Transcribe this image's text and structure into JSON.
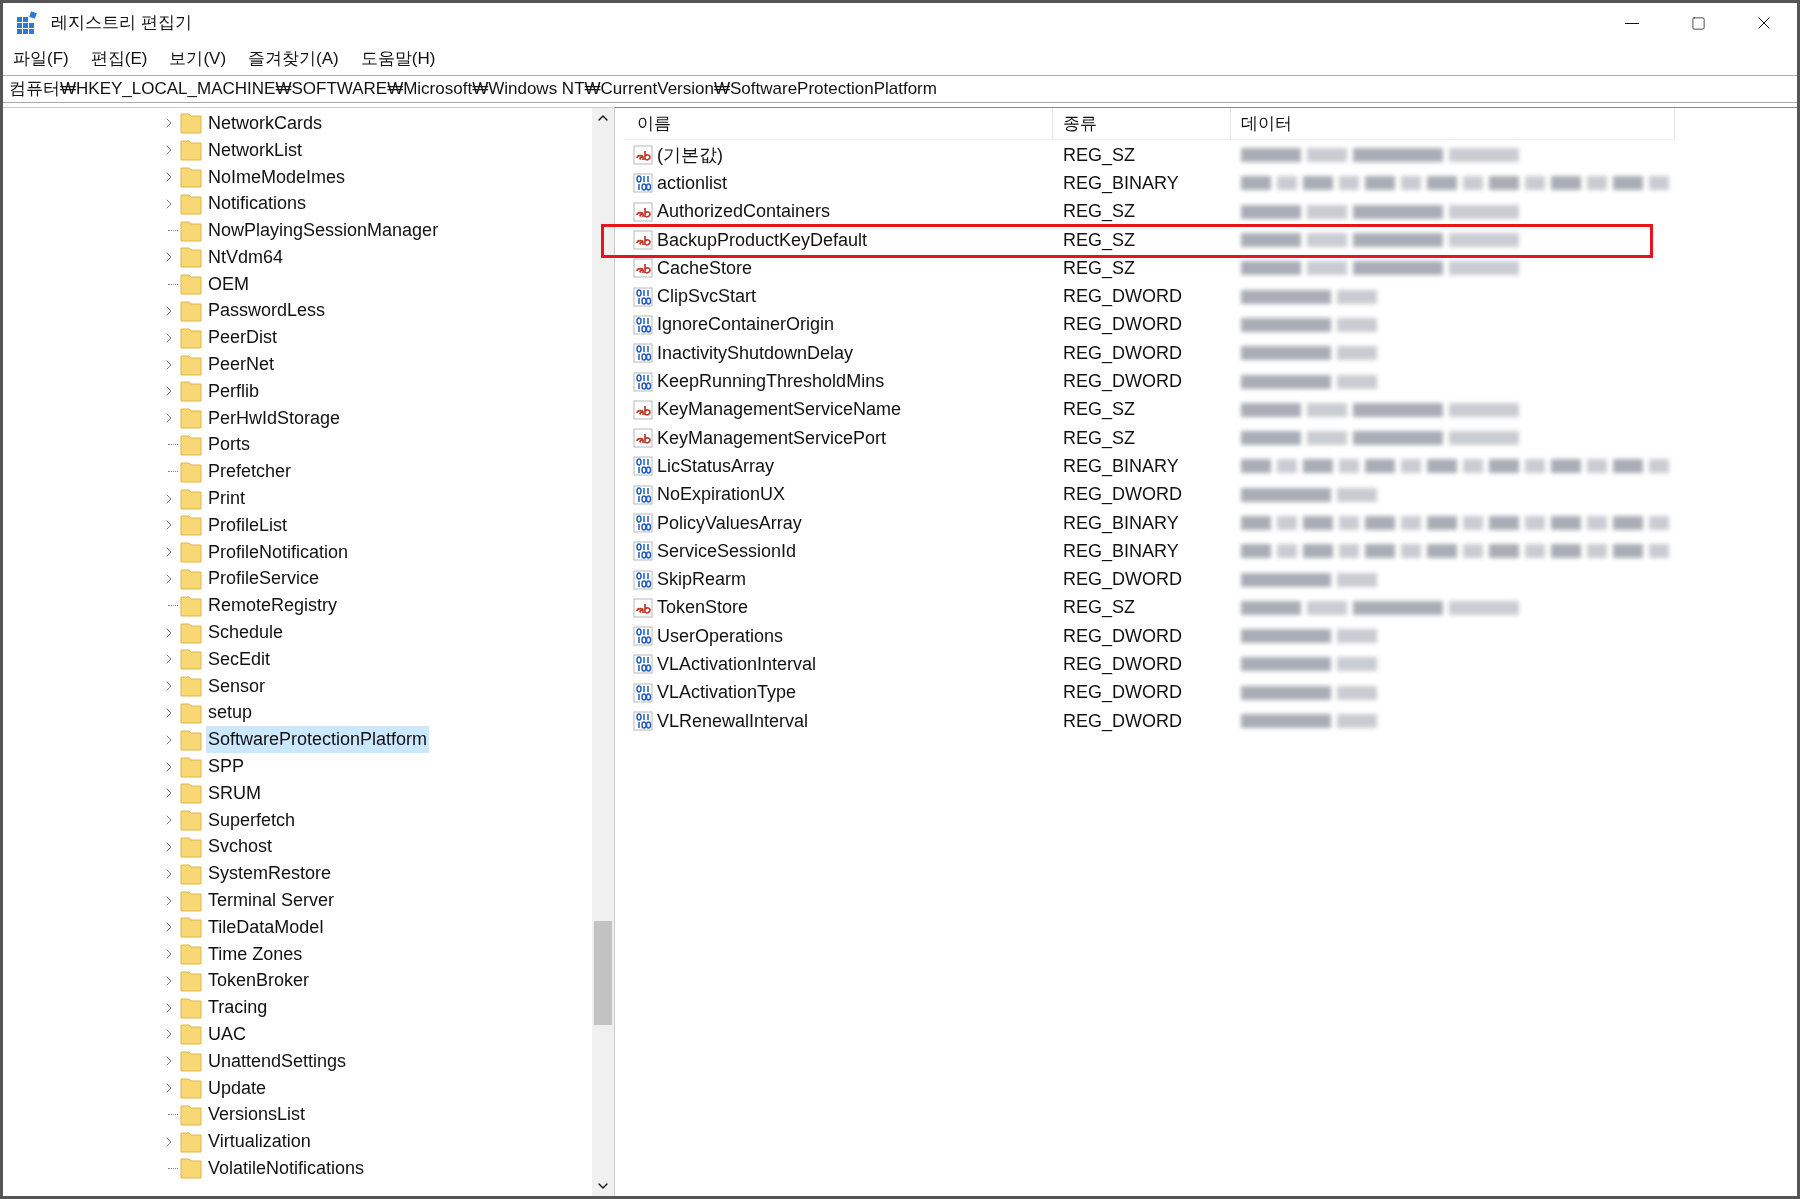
{
  "window": {
    "title": "레지스트리 편집기"
  },
  "menu": [
    "파일(F)",
    "편집(E)",
    "보기(V)",
    "즐겨찾기(A)",
    "도움말(H)"
  ],
  "address": "컴퓨터₩HKEY_LOCAL_MACHINE₩SOFTWARE₩Microsoft₩Windows NT₩CurrentVersion₩SoftwareProtectionPlatform",
  "tree": [
    {
      "label": "NetworkCards",
      "expandable": true,
      "selected": false
    },
    {
      "label": "NetworkList",
      "expandable": true,
      "selected": false
    },
    {
      "label": "NoImeModeImes",
      "expandable": true,
      "selected": false
    },
    {
      "label": "Notifications",
      "expandable": true,
      "selected": false
    },
    {
      "label": "NowPlayingSessionManager",
      "expandable": false,
      "selected": false
    },
    {
      "label": "NtVdm64",
      "expandable": true,
      "selected": false
    },
    {
      "label": "OEM",
      "expandable": false,
      "selected": false
    },
    {
      "label": "PasswordLess",
      "expandable": true,
      "selected": false
    },
    {
      "label": "PeerDist",
      "expandable": true,
      "selected": false
    },
    {
      "label": "PeerNet",
      "expandable": true,
      "selected": false
    },
    {
      "label": "Perflib",
      "expandable": true,
      "selected": false
    },
    {
      "label": "PerHwIdStorage",
      "expandable": true,
      "selected": false
    },
    {
      "label": "Ports",
      "expandable": false,
      "selected": false
    },
    {
      "label": "Prefetcher",
      "expandable": false,
      "selected": false
    },
    {
      "label": "Print",
      "expandable": true,
      "selected": false
    },
    {
      "label": "ProfileList",
      "expandable": true,
      "selected": false
    },
    {
      "label": "ProfileNotification",
      "expandable": true,
      "selected": false
    },
    {
      "label": "ProfileService",
      "expandable": true,
      "selected": false
    },
    {
      "label": "RemoteRegistry",
      "expandable": false,
      "selected": false
    },
    {
      "label": "Schedule",
      "expandable": true,
      "selected": false
    },
    {
      "label": "SecEdit",
      "expandable": true,
      "selected": false
    },
    {
      "label": "Sensor",
      "expandable": true,
      "selected": false
    },
    {
      "label": "setup",
      "expandable": true,
      "selected": false
    },
    {
      "label": "SoftwareProtectionPlatform",
      "expandable": true,
      "selected": true
    },
    {
      "label": "SPP",
      "expandable": true,
      "selected": false
    },
    {
      "label": "SRUM",
      "expandable": true,
      "selected": false
    },
    {
      "label": "Superfetch",
      "expandable": true,
      "selected": false
    },
    {
      "label": "Svchost",
      "expandable": true,
      "selected": false
    },
    {
      "label": "SystemRestore",
      "expandable": true,
      "selected": false
    },
    {
      "label": "Terminal Server",
      "expandable": true,
      "selected": false
    },
    {
      "label": "TileDataModel",
      "expandable": true,
      "selected": false
    },
    {
      "label": "Time Zones",
      "expandable": true,
      "selected": false
    },
    {
      "label": "TokenBroker",
      "expandable": true,
      "selected": false
    },
    {
      "label": "Tracing",
      "expandable": true,
      "selected": false
    },
    {
      "label": "UAC",
      "expandable": true,
      "selected": false
    },
    {
      "label": "UnattendSettings",
      "expandable": true,
      "selected": false
    },
    {
      "label": "Update",
      "expandable": true,
      "selected": false
    },
    {
      "label": "VersionsList",
      "expandable": false,
      "selected": false
    },
    {
      "label": "Virtualization",
      "expandable": true,
      "selected": false
    },
    {
      "label": "VolatileNotifications",
      "expandable": false,
      "selected": false
    }
  ],
  "values": {
    "columns": [
      "이름",
      "종류",
      "데이터"
    ],
    "rows": [
      {
        "kind": "string",
        "name": "(기본값)",
        "type": "REG_SZ",
        "highlighted": false
      },
      {
        "kind": "binary",
        "name": "actionlist",
        "type": "REG_BINARY",
        "highlighted": false
      },
      {
        "kind": "string",
        "name": "AuthorizedContainers",
        "type": "REG_SZ",
        "highlighted": false
      },
      {
        "kind": "string",
        "name": "BackupProductKeyDefault",
        "type": "REG_SZ",
        "highlighted": true
      },
      {
        "kind": "string",
        "name": "CacheStore",
        "type": "REG_SZ",
        "highlighted": false
      },
      {
        "kind": "binary",
        "name": "ClipSvcStart",
        "type": "REG_DWORD",
        "highlighted": false
      },
      {
        "kind": "binary",
        "name": "IgnoreContainerOrigin",
        "type": "REG_DWORD",
        "highlighted": false
      },
      {
        "kind": "binary",
        "name": "InactivityShutdownDelay",
        "type": "REG_DWORD",
        "highlighted": false
      },
      {
        "kind": "binary",
        "name": "KeepRunningThresholdMins",
        "type": "REG_DWORD",
        "highlighted": false
      },
      {
        "kind": "string",
        "name": "KeyManagementServiceName",
        "type": "REG_SZ",
        "highlighted": false
      },
      {
        "kind": "string",
        "name": "KeyManagementServicePort",
        "type": "REG_SZ",
        "highlighted": false
      },
      {
        "kind": "binary",
        "name": "LicStatusArray",
        "type": "REG_BINARY",
        "highlighted": false
      },
      {
        "kind": "binary",
        "name": "NoExpirationUX",
        "type": "REG_DWORD",
        "highlighted": false
      },
      {
        "kind": "binary",
        "name": "PolicyValuesArray",
        "type": "REG_BINARY",
        "highlighted": false
      },
      {
        "kind": "binary",
        "name": "ServiceSessionId",
        "type": "REG_BINARY",
        "highlighted": false
      },
      {
        "kind": "binary",
        "name": "SkipRearm",
        "type": "REG_DWORD",
        "highlighted": false
      },
      {
        "kind": "string",
        "name": "TokenStore",
        "type": "REG_SZ",
        "highlighted": false
      },
      {
        "kind": "binary",
        "name": "UserOperations",
        "type": "REG_DWORD",
        "highlighted": false
      },
      {
        "kind": "binary",
        "name": "VLActivationInterval",
        "type": "REG_DWORD",
        "highlighted": false
      },
      {
        "kind": "binary",
        "name": "VLActivationType",
        "type": "REG_DWORD",
        "highlighted": false
      },
      {
        "kind": "binary",
        "name": "VLRenewalInterval",
        "type": "REG_DWORD",
        "highlighted": false
      }
    ]
  }
}
